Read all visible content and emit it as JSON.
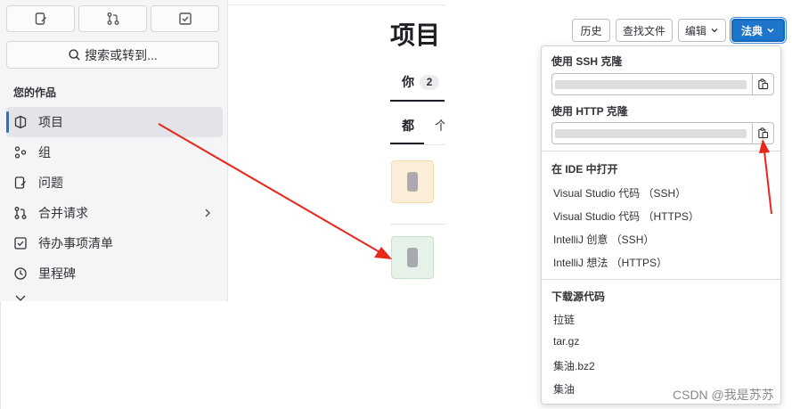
{
  "sidebar": {
    "top_buttons": [
      {
        "icon": "issues-icon"
      },
      {
        "icon": "merge-request-icon"
      },
      {
        "icon": "todo-icon"
      }
    ],
    "search_label": "搜索或转到...",
    "section_title": "您的作品",
    "items": [
      {
        "label": "项目",
        "icon": "project-icon",
        "active": true
      },
      {
        "label": "组",
        "icon": "group-icon"
      },
      {
        "label": "问题",
        "icon": "issues-icon"
      },
      {
        "label": "合并请求",
        "icon": "merge-request-icon",
        "has_chevron": true
      },
      {
        "label": "待办事项清单",
        "icon": "todo-icon"
      },
      {
        "label": "里程碑",
        "icon": "milestone-icon"
      }
    ]
  },
  "main": {
    "title": "项目",
    "tab_you": {
      "label": "你",
      "count": "2"
    },
    "subtab_all": "都",
    "subtab_next": "个"
  },
  "header": {
    "history": "历史",
    "find_file": "查找文件",
    "edit": "编辑",
    "clone": "法典"
  },
  "dropdown": {
    "ssh_label": "使用 SSH 克隆",
    "http_label": "使用 HTTP 克隆",
    "ide_title": "在 IDE 中打开",
    "ide_items": [
      "Visual Studio 代码 （SSH）",
      "Visual Studio 代码 （HTTPS）",
      "IntelliJ 创意 （SSH）",
      "IntelliJ 想法 （HTTPS）"
    ],
    "download_title": "下载源代码",
    "download_items": [
      "拉链",
      "tar.gz",
      "集油.bz2",
      "集油"
    ]
  },
  "colors": {
    "accent": "#1f75cb",
    "annotation_arrow": "#e8261c"
  },
  "watermark": "CSDN @我是苏苏"
}
